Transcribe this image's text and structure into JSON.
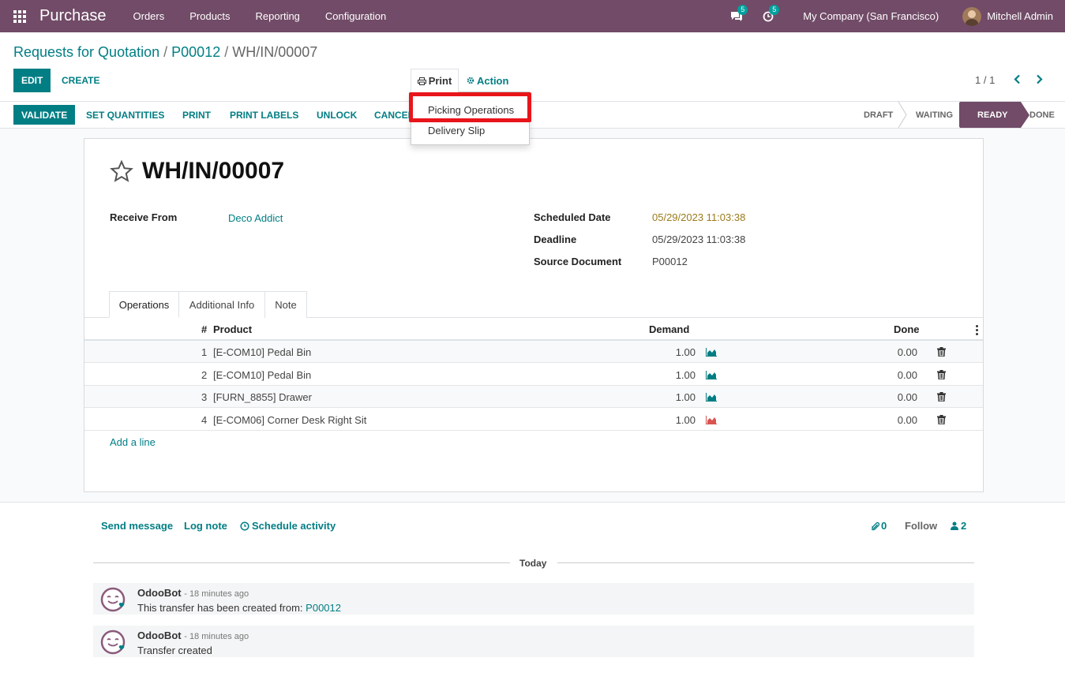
{
  "navbar": {
    "app_name": "Purchase",
    "menu": [
      "Orders",
      "Products",
      "Reporting",
      "Configuration"
    ],
    "messages_count": "5",
    "activities_count": "5",
    "company": "My Company (San Francisco)",
    "user": "Mitchell Admin"
  },
  "breadcrumb": {
    "root": "Requests for Quotation",
    "sep": "/",
    "parent": "P00012",
    "current": "WH/IN/00007"
  },
  "control": {
    "edit": "Edit",
    "create": "Create",
    "print": "Print",
    "action": "Action",
    "pager": "1 / 1"
  },
  "print_menu": {
    "items": [
      "Picking Operations",
      "Delivery Slip"
    ]
  },
  "statusbar": {
    "buttons": [
      "Validate",
      "Set Quantities",
      "Print",
      "Print Labels",
      "Unlock",
      "Cancel"
    ],
    "stages": [
      "Draft",
      "Waiting",
      "Ready",
      "Done"
    ],
    "active_stage": "Ready"
  },
  "record": {
    "title": "WH/IN/00007",
    "receive_from_label": "Receive From",
    "receive_from": "Deco Addict",
    "scheduled_date_label": "Scheduled Date",
    "scheduled_date": "05/29/2023 11:03:38",
    "deadline_label": "Deadline",
    "deadline": "05/29/2023 11:03:38",
    "source_label": "Source Document",
    "source": "P00012"
  },
  "tabs": [
    "Operations",
    "Additional Info",
    "Note"
  ],
  "table": {
    "headers": {
      "num": "#",
      "product": "Product",
      "demand": "Demand",
      "done": "Done"
    },
    "rows": [
      {
        "num": "1",
        "product": "[E-COM10] Pedal Bin",
        "demand": "1.00",
        "done": "0.00",
        "forecast": "#017e84"
      },
      {
        "num": "2",
        "product": "[E-COM10] Pedal Bin",
        "demand": "1.00",
        "done": "0.00",
        "forecast": "#017e84"
      },
      {
        "num": "3",
        "product": "[FURN_8855] Drawer",
        "demand": "1.00",
        "done": "0.00",
        "forecast": "#017e84"
      },
      {
        "num": "4",
        "product": "[E-COM06] Corner Desk Right Sit",
        "demand": "1.00",
        "done": "0.00",
        "forecast": "#d9534f"
      }
    ],
    "add_line": "Add a line"
  },
  "chatter": {
    "send_message": "Send message",
    "log_note": "Log note",
    "schedule_activity": "Schedule activity",
    "attachments": "0",
    "follow": "Follow",
    "followers": "2",
    "today": "Today",
    "messages": [
      {
        "author": "OdooBot",
        "date": "- 18 minutes ago",
        "body": "This transfer has been created from:",
        "link": "P00012"
      },
      {
        "author": "OdooBot",
        "date": "- 18 minutes ago",
        "body": "Transfer created",
        "link": ""
      }
    ]
  },
  "colors": {
    "brand": "#714B67",
    "accent": "#017e84",
    "highlight": "#e8151b"
  }
}
